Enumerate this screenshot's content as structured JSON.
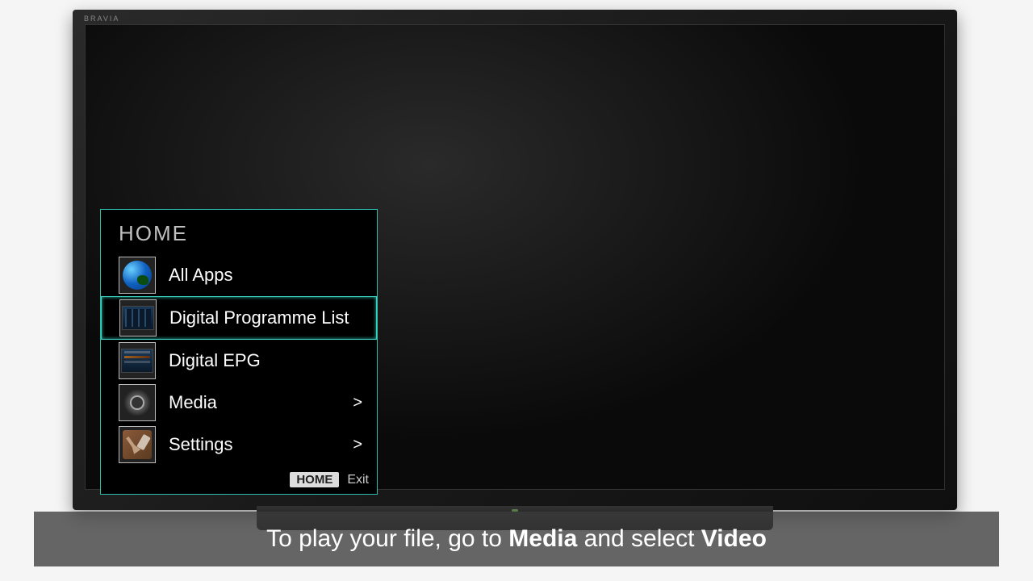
{
  "tv_brand": "BRAVIA",
  "menu": {
    "title": "HOME",
    "items": [
      {
        "label": "All Apps",
        "has_submenu": false,
        "selected": false,
        "icon": "globe"
      },
      {
        "label": "Digital Programme List",
        "has_submenu": false,
        "selected": true,
        "icon": "prog"
      },
      {
        "label": "Digital EPG",
        "has_submenu": false,
        "selected": false,
        "icon": "epg"
      },
      {
        "label": "Media",
        "has_submenu": true,
        "selected": false,
        "icon": "media"
      },
      {
        "label": "Settings",
        "has_submenu": true,
        "selected": false,
        "icon": "settings"
      }
    ],
    "footer_home": "HOME",
    "footer_exit": "Exit",
    "submenu_arrow": ">"
  },
  "caption": {
    "pre": "To play your file, go to ",
    "bold1": "Media",
    "mid": " and select ",
    "bold2": "Video"
  }
}
